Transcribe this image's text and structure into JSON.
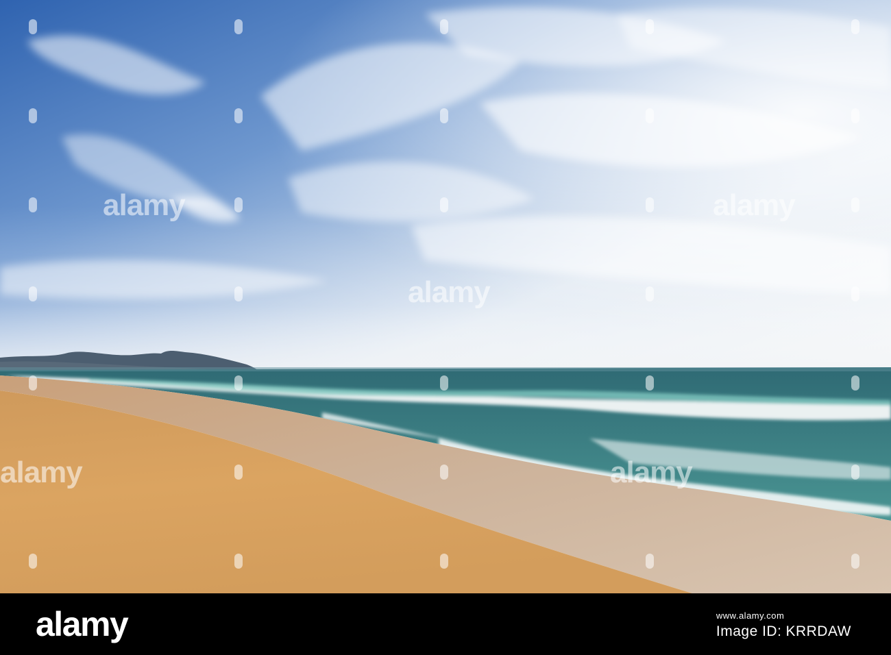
{
  "watermark": {
    "text": "alamy",
    "color": "#ffffff"
  },
  "footer": {
    "brand": "alamy",
    "image_id_label": "Image ID:",
    "image_id": "KRRDAW",
    "url": "www.alamy.com"
  },
  "scene": {
    "sky_top_color": "#3f76c0",
    "sky_horizon_color": "#eef2f6",
    "sea_color": "#3b7d80",
    "foam_color": "#f4f8f8",
    "sand_color": "#d9a25a",
    "wet_sand_color": "#c9a888",
    "island_color": "#4c5e70"
  }
}
